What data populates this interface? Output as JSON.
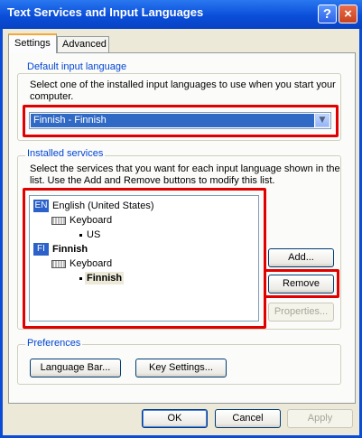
{
  "window": {
    "title": "Text Services and Input Languages"
  },
  "titlebar": {
    "help_label": "?",
    "close_label": "×"
  },
  "tabs": [
    {
      "label": "Settings"
    },
    {
      "label": "Advanced"
    }
  ],
  "default_language": {
    "legend": "Default input language",
    "description_line1": "Select one of the installed input languages to use when you start your",
    "description_line2": "computer.",
    "selected": "Finnish - Finnish"
  },
  "installed_services": {
    "legend": "Installed services",
    "description_line1": "Select the services that you want for each input language shown in the",
    "description_line2": "list. Use the Add and Remove buttons to modify this list.",
    "tree": [
      {
        "badge": "EN",
        "language": "English (United States)",
        "category": "Keyboard",
        "layout": "US"
      },
      {
        "badge": "FI",
        "language": "Finnish",
        "category": "Keyboard",
        "layout": "Finnish"
      }
    ],
    "add_label": "Add...",
    "remove_label": "Remove",
    "properties_label": "Properties..."
  },
  "preferences": {
    "legend": "Preferences",
    "language_bar_label": "Language Bar...",
    "key_settings_label": "Key Settings..."
  },
  "footer": {
    "ok_label": "OK",
    "cancel_label": "Cancel",
    "apply_label": "Apply"
  },
  "colors": {
    "title_bar": "#0a4ed9",
    "highlight": "#e00000",
    "selection": "#316ac5",
    "legend": "#0046d5"
  }
}
